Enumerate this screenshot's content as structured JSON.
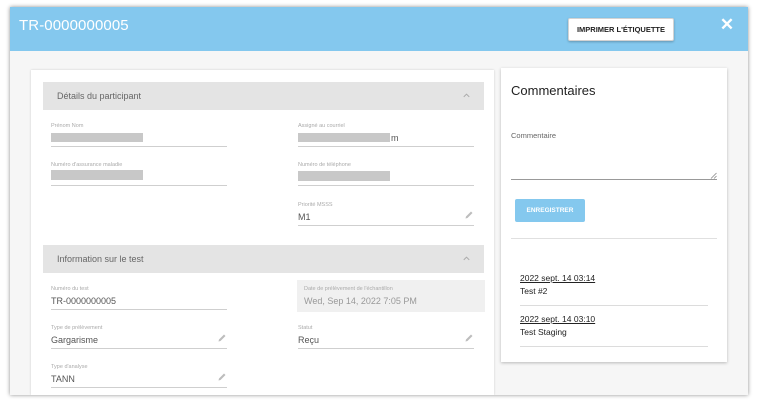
{
  "header": {
    "title": "TR-0000000005",
    "print_label": "IMPRIMER L'ÉTIQUETTE",
    "close_label": "✕"
  },
  "participant": {
    "title": "Détails du participant",
    "first_name_label": "Prénom Nom",
    "assigned_label": "Assigné au courriel",
    "assigned_value_tail": "m",
    "insurance_label": "Numéro d'assurance maladie",
    "phone_label": "Numéro de téléphone",
    "priority_label": "Priorité MSSS",
    "priority_value": "M1"
  },
  "test_info": {
    "title": "Information sur le test",
    "test_number_label": "Numéro du test",
    "test_number_value": "TR-0000000005",
    "sample_date_label": "Date de prélèvement de l'échantillon",
    "sample_date_value": "Wed, Sep 14, 2022 7:05 PM",
    "sample_type_label": "Type de prélèvement",
    "sample_type_value": "Gargarisme",
    "status_label": "Statut",
    "status_value": "Reçu",
    "analysis_label": "Type d'analyse",
    "analysis_value": "TANN"
  },
  "comments": {
    "title": "Commentaires",
    "comment_label": "Commentaire",
    "comment_value": "",
    "save_label": "ENREGISTRER",
    "items": [
      {
        "date": "2022 sept. 14 03:14",
        "text": "Test #2"
      },
      {
        "date": "2022 sept. 14 03:10",
        "text": "Test Staging"
      }
    ]
  },
  "colors": {
    "accent": "#84c8ee",
    "section_header": "#e4e4e4"
  }
}
